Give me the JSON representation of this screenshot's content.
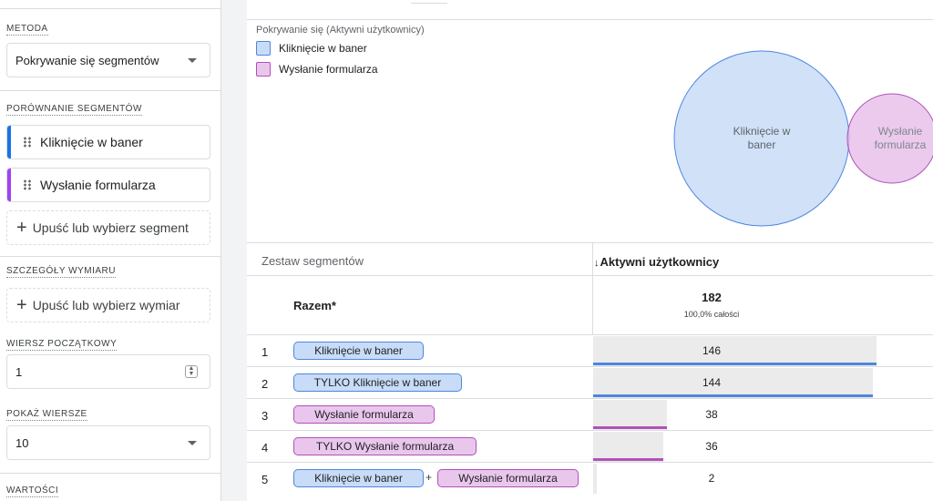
{
  "left_panel": {
    "method": {
      "label": "METODA",
      "value": "Pokrywanie się segmentów"
    },
    "segment_comparison": {
      "label": "PORÓWNANIE SEGMENTÓW",
      "segments": [
        {
          "name": "Kliknięcie w baner",
          "color": "#1a73e8"
        },
        {
          "name": "Wysłanie formularza",
          "color": "#a142f4"
        }
      ],
      "drop_label": "Upuść lub wybierz segment"
    },
    "dimension_details": {
      "label": "SZCZEGÓŁY WYMIARU",
      "drop_label": "Upuść lub wybierz wymiar"
    },
    "start_row": {
      "label": "WIERSZ POCZĄTKOWY",
      "value": "1"
    },
    "show_rows": {
      "label": "POKAŻ WIERSZE",
      "value": "10"
    },
    "values": {
      "label": "WARTOŚCI"
    }
  },
  "chart": {
    "title": "Pokrywanie się (Aktywni użytkownicy)",
    "legend": [
      {
        "name": "Kliknięcie w baner",
        "fill": "#c8dcf7",
        "stroke": "#4f86e0"
      },
      {
        "name": "Wysłanie formularza",
        "fill": "#e9c7ec",
        "stroke": "#b150b8"
      }
    ],
    "circle_labels": {
      "a_line1": "Kliknięcie w",
      "a_line2": "baner",
      "b_line1": "Wysłanie",
      "b_line2": "formularza"
    }
  },
  "chart_data": {
    "type": "venn",
    "metric": "Aktywni użytkownicy",
    "sets": [
      {
        "name": "Kliknięcie w baner",
        "size": 146
      },
      {
        "name": "Wysłanie formularza",
        "size": 38
      }
    ],
    "intersection": 2,
    "total": 182
  },
  "table": {
    "col_segment_set": "Zestaw segmentów",
    "col_metric": "Aktywni użytkownicy",
    "sort_arrow": "↓",
    "total": {
      "label": "Razem*",
      "value": "182",
      "pct": "100,0% całości",
      "numeric": 182
    },
    "rows": [
      {
        "num": "1",
        "chips": [
          {
            "text": "Kliknięcie w baner",
            "color": "blue"
          }
        ],
        "value": "146",
        "numeric": 146,
        "line": "#4f86e0"
      },
      {
        "num": "2",
        "chips": [
          {
            "text": "TYLKO Kliknięcie w baner",
            "color": "blue"
          }
        ],
        "value": "144",
        "numeric": 144,
        "line": "#4f86e0"
      },
      {
        "num": "3",
        "chips": [
          {
            "text": "Wysłanie formularza",
            "color": "purple"
          }
        ],
        "value": "38",
        "numeric": 38,
        "line": "#b150b8"
      },
      {
        "num": "4",
        "chips": [
          {
            "text": "TYLKO Wysłanie formularza",
            "color": "purple"
          }
        ],
        "value": "36",
        "numeric": 36,
        "line": "#b150b8"
      },
      {
        "num": "5",
        "chips": [
          {
            "text": "Kliknięcie w baner",
            "color": "blue"
          },
          {
            "text": "Wysłanie formularza",
            "color": "purple"
          }
        ],
        "plus": "+",
        "value": "2",
        "numeric": 2,
        "line": ""
      }
    ]
  }
}
